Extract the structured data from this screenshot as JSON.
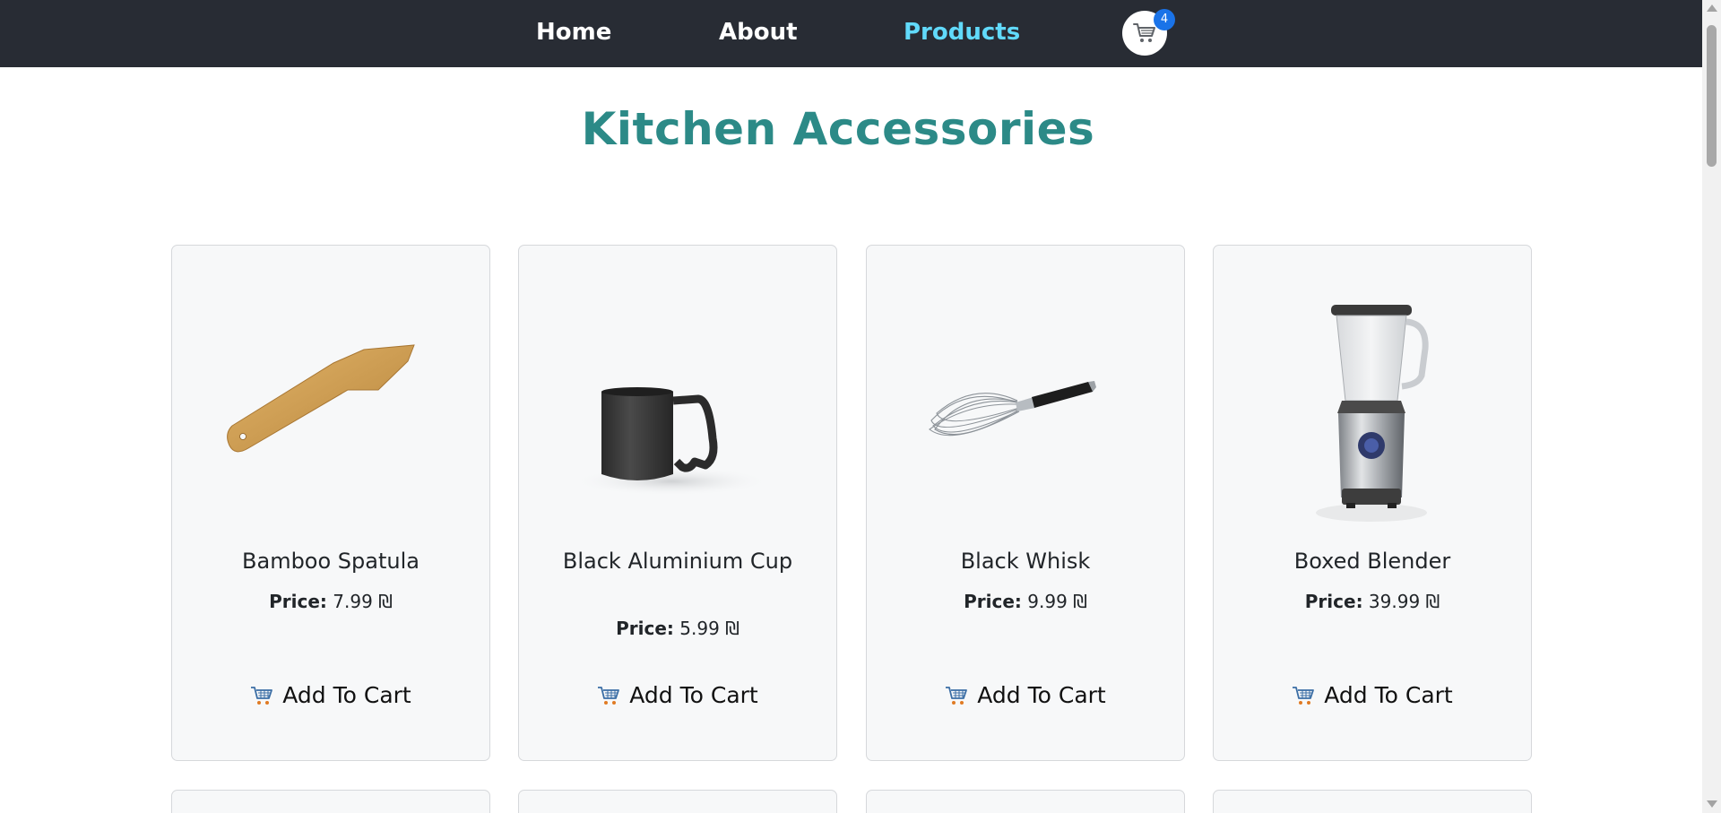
{
  "nav": {
    "home": "Home",
    "about": "About",
    "products": "Products",
    "cart_count": "4",
    "active_color": "#61dafb",
    "bg_color": "#282c34",
    "cart_icon": "shopping-cart-icon"
  },
  "page": {
    "title": "Kitchen Accessories",
    "title_color": "#2c8a87"
  },
  "products": [
    {
      "name": "Bamboo Spatula",
      "price_label": "Price:",
      "price": "7.99 ₪",
      "button": "Add To Cart",
      "image": "bamboo-spatula"
    },
    {
      "name": "Black Aluminium Cup",
      "price_label": "Price:",
      "price": "5.99 ₪",
      "button": "Add To Cart",
      "image": "black-aluminium-cup"
    },
    {
      "name": "Black Whisk",
      "price_label": "Price:",
      "price": "9.99 ₪",
      "button": "Add To Cart",
      "image": "black-whisk"
    },
    {
      "name": "Boxed Blender",
      "price_label": "Price:",
      "price": "39.99 ₪",
      "button": "Add To Cart",
      "image": "boxed-blender"
    }
  ]
}
